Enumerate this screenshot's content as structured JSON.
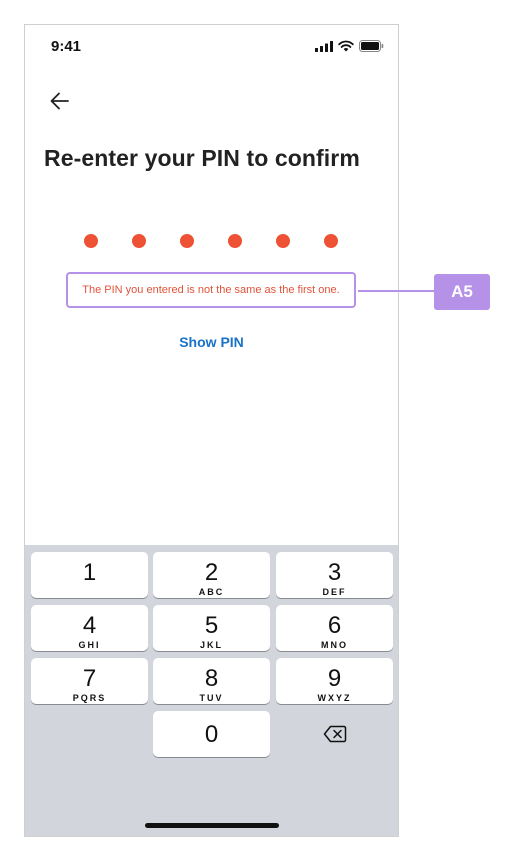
{
  "status_bar": {
    "time": "9:41",
    "icons": [
      "signal-icon",
      "wifi-icon",
      "battery-icon"
    ]
  },
  "header": {
    "back_icon": "arrow-left-icon",
    "title": "Re-enter your PIN to confirm"
  },
  "pin": {
    "digits_entered": 6,
    "dot_color": "#ee5235"
  },
  "error": {
    "message": "The PIN you entered is not the same as the first one.",
    "color": "#e2533a"
  },
  "show_pin": {
    "label": "Show PIN",
    "color": "#1a73c9"
  },
  "keypad": {
    "keys": [
      {
        "num": "1",
        "letters": ""
      },
      {
        "num": "2",
        "letters": "ABC"
      },
      {
        "num": "3",
        "letters": "DEF"
      },
      {
        "num": "4",
        "letters": "GHI"
      },
      {
        "num": "5",
        "letters": "JKL"
      },
      {
        "num": "6",
        "letters": "MNO"
      },
      {
        "num": "7",
        "letters": "PQRS"
      },
      {
        "num": "8",
        "letters": "TUV"
      },
      {
        "num": "9",
        "letters": "WXYZ"
      }
    ],
    "zero": {
      "num": "0"
    },
    "delete_icon": "backspace-icon"
  },
  "annotation": {
    "label": "A5",
    "color": "#b591e8"
  }
}
